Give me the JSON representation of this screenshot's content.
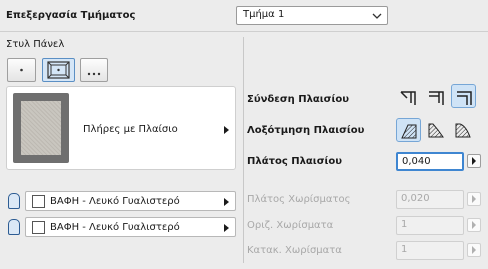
{
  "header": {
    "title": "Επεξεργασία Τμήματος",
    "segment_selected": "Τμήμα 1"
  },
  "panel_style": {
    "label": "Στυλ Πάνελ",
    "card_label": "Πλήρες με Πλαίσιο"
  },
  "materials": [
    {
      "label": "ΒΑΦΗ - Λευκό Γυαλιστερό"
    },
    {
      "label": "ΒΑΦΗ - Λευκό Γυαλιστερό"
    }
  ],
  "settings": {
    "frame_connection": "Σύνδεση Πλαισίου",
    "frame_bevel": "Λοξότμηση Πλαισίου",
    "frame_width": {
      "label": "Πλάτος Πλαισίου",
      "value": "0,040"
    },
    "groove_width": {
      "label": "Πλάτος Χωρίσματος",
      "value": "0,020"
    },
    "horizontal_grooves": {
      "label": "Οριζ. Χωρίσματα",
      "value": "1"
    },
    "vertical_grooves": {
      "label": "Κατακ. Χωρίσματα",
      "value": "1"
    }
  },
  "colors": {
    "accent": "#3f86d1",
    "active_bg": "#cfe3f6"
  }
}
